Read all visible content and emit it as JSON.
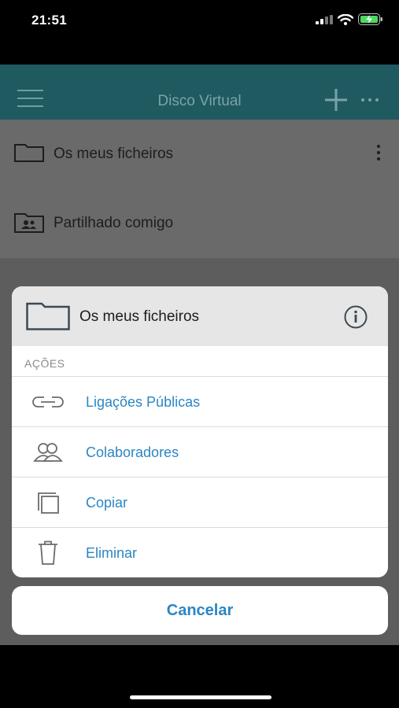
{
  "status_bar": {
    "time": "21:51",
    "icons": [
      "signal-icon",
      "wifi-icon",
      "battery-charging-icon"
    ]
  },
  "header": {
    "title": "Disco Virtual",
    "icons": [
      "hamburger-menu-icon",
      "plus-icon",
      "more-horizontal-icon"
    ]
  },
  "list": {
    "items": [
      {
        "label": "Os meus ficheiros",
        "icon": "folder-icon",
        "has_menu": true
      },
      {
        "label": "Partilhado comigo",
        "icon": "shared-folder-icon",
        "has_menu": false
      }
    ]
  },
  "action_sheet": {
    "title": "Os meus ficheiros",
    "title_icon": "folder-icon",
    "info_icon": "info-icon",
    "section_label": "AÇÕES",
    "actions": [
      {
        "label": "Ligações Públicas",
        "icon": "link-icon"
      },
      {
        "label": "Colaboradores",
        "icon": "collaborators-icon"
      },
      {
        "label": "Copiar",
        "icon": "copy-icon"
      },
      {
        "label": "Eliminar",
        "icon": "trash-icon"
      }
    ],
    "cancel_label": "Cancelar"
  },
  "colors": {
    "header_bg": "#1f5a61",
    "accent": "#2b86c2",
    "overlay": "#5d5d5d"
  }
}
